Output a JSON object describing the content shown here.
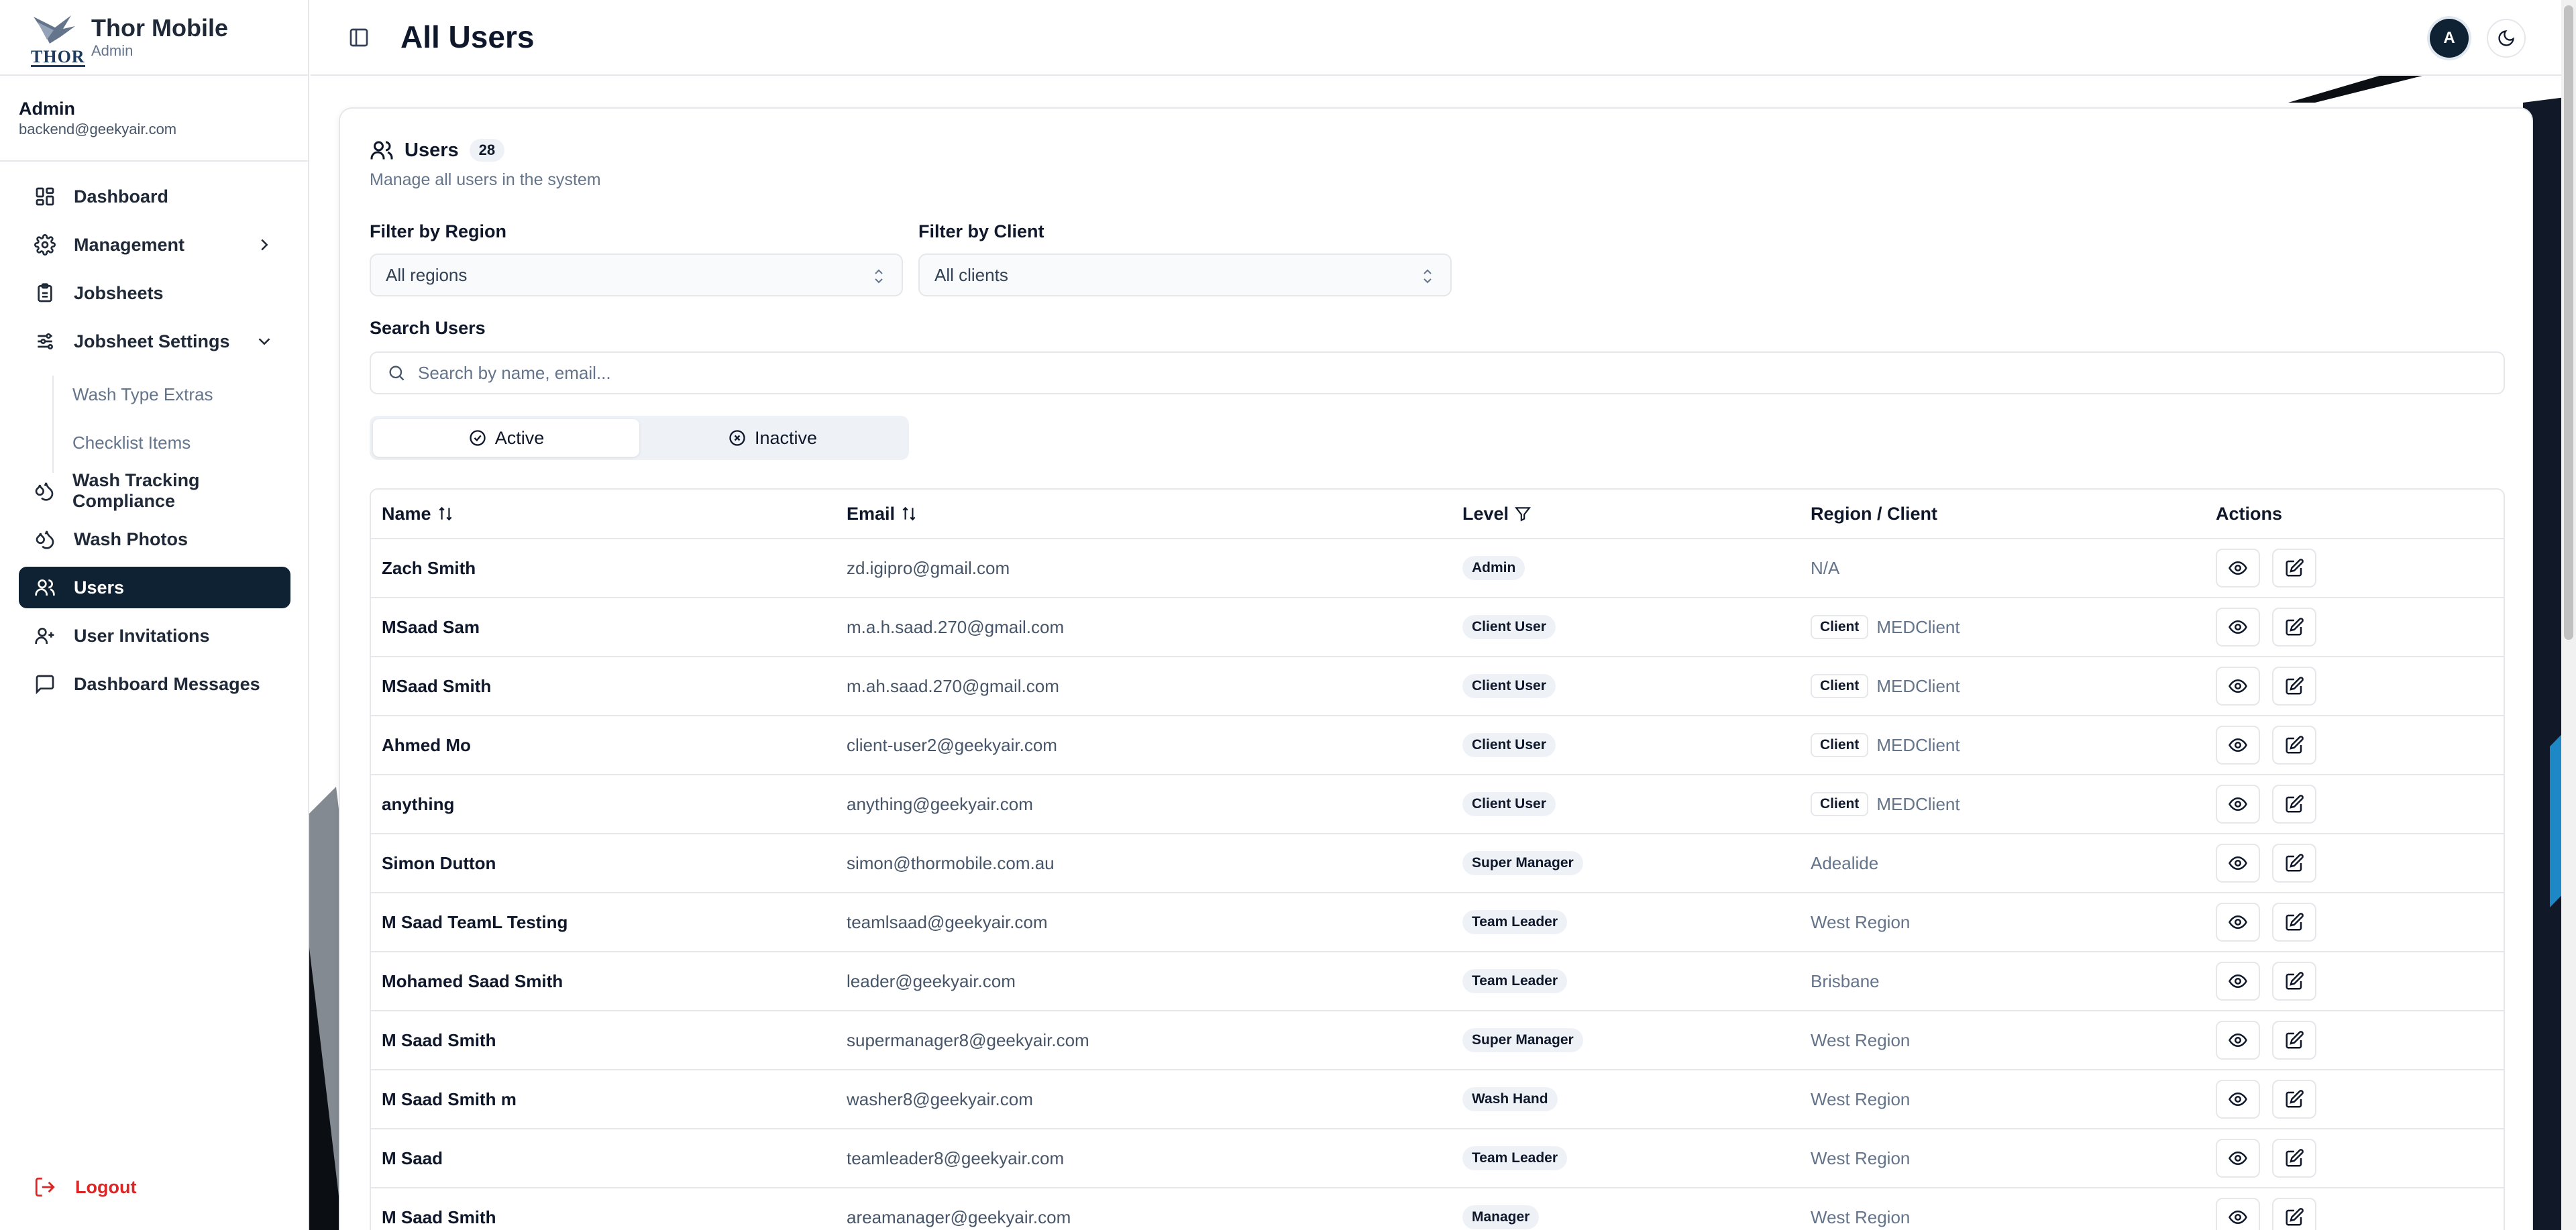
{
  "brand": {
    "title": "Thor Mobile",
    "subtitle": "Admin",
    "logo_text": "THOR"
  },
  "user": {
    "name": "Admin",
    "email": "backend@geekyair.com"
  },
  "nav": {
    "items": [
      {
        "label": "Dashboard",
        "icon": "dashboard-icon"
      },
      {
        "label": "Management",
        "icon": "gear-icon"
      },
      {
        "label": "Jobsheets",
        "icon": "clipboard-icon"
      },
      {
        "label": "Jobsheet Settings",
        "icon": "sliders-icon"
      },
      {
        "label": "Wash Tracking Compliance",
        "icon": "droplets-icon"
      },
      {
        "label": "Wash Photos",
        "icon": "droplets-icon"
      },
      {
        "label": "Users",
        "icon": "users-icon"
      },
      {
        "label": "User Invitations",
        "icon": "user-plus-icon"
      },
      {
        "label": "Dashboard Messages",
        "icon": "message-icon"
      }
    ],
    "sub_items": [
      "Wash Type Extras",
      "Checklist Items"
    ],
    "logout": "Logout"
  },
  "header": {
    "title": "All Users",
    "avatar_initial": "A"
  },
  "card": {
    "title": "Users",
    "count": "28",
    "description": "Manage all users in the system"
  },
  "filters": {
    "region_label": "Filter by Region",
    "region_value": "All regions",
    "client_label": "Filter by Client",
    "client_value": "All clients",
    "search_label": "Search Users",
    "search_placeholder": "Search by name, email..."
  },
  "status_toggle": {
    "active": "Active",
    "inactive": "Inactive",
    "selected": "Active"
  },
  "table": {
    "columns": [
      "Name",
      "Email",
      "Level",
      "Region / Client",
      "Actions"
    ],
    "rows": [
      {
        "name": "Zach Smith",
        "email": "zd.igipro@gmail.com",
        "level": "Admin",
        "region": "N/A",
        "client_tag": ""
      },
      {
        "name": "MSaad Sam",
        "email": "m.a.h.saad.270@gmail.com",
        "level": "Client User",
        "region": "MEDClient",
        "client_tag": "Client"
      },
      {
        "name": "MSaad Smith",
        "email": "m.ah.saad.270@gmail.com",
        "level": "Client User",
        "region": "MEDClient",
        "client_tag": "Client"
      },
      {
        "name": "Ahmed Mo",
        "email": "client-user2@geekyair.com",
        "level": "Client User",
        "region": "MEDClient",
        "client_tag": "Client"
      },
      {
        "name": "anything",
        "email": "anything@geekyair.com",
        "level": "Client User",
        "region": "MEDClient",
        "client_tag": "Client"
      },
      {
        "name": "Simon Dutton",
        "email": "simon@thormobile.com.au",
        "level": "Super Manager",
        "region": "Adealide",
        "client_tag": ""
      },
      {
        "name": "M Saad TeamL Testing",
        "email": "teamlsaad@geekyair.com",
        "level": "Team Leader",
        "region": "West Region",
        "client_tag": ""
      },
      {
        "name": "Mohamed Saad Smith",
        "email": "leader@geekyair.com",
        "level": "Team Leader",
        "region": "Brisbane",
        "client_tag": ""
      },
      {
        "name": "M Saad Smith",
        "email": "supermanager8@geekyair.com",
        "level": "Super Manager",
        "region": "West Region",
        "client_tag": ""
      },
      {
        "name": "M Saad Smith m",
        "email": "washer8@geekyair.com",
        "level": "Wash Hand",
        "region": "West Region",
        "client_tag": ""
      },
      {
        "name": "M Saad",
        "email": "teamleader8@geekyair.com",
        "level": "Team Leader",
        "region": "West Region",
        "client_tag": ""
      },
      {
        "name": "M Saad Smith",
        "email": "areamanager@geekyair.com",
        "level": "Manager",
        "region": "West Region",
        "client_tag": ""
      }
    ]
  },
  "colors": {
    "primary": "#0f2233",
    "danger": "#dc2626",
    "muted": "#64748b"
  }
}
